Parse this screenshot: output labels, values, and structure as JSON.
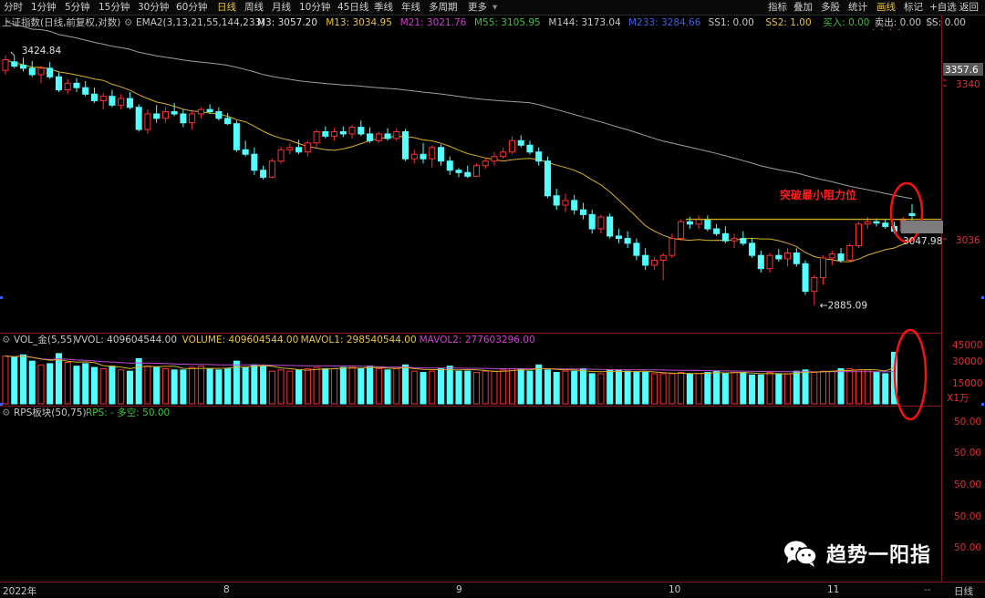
{
  "toolbar": {
    "periods": [
      "分时",
      "1分钟",
      "5分钟",
      "15分钟",
      "30分钟",
      "60分钟",
      "日线",
      "周线",
      "月线",
      "10分钟",
      "45日线",
      "季线",
      "年线",
      "多周期",
      "更多"
    ],
    "active_period": "日线",
    "right_buttons": [
      "指标",
      "叠加",
      "多股",
      "统计",
      "画线",
      "标记",
      "+自选",
      "返回"
    ],
    "active_right": "画线"
  },
  "main": {
    "title": "上证指数(日线,前复权,对数)",
    "indicator_name": "EMA2(3,13,21,55,144,233)",
    "indicators": [
      {
        "label": "M3: 3057.20",
        "color": "#e0e0e0"
      },
      {
        "label": "M13: 3034.95",
        "color": "#e6c43e"
      },
      {
        "label": "M21: 3021.76",
        "color": "#d040d0"
      },
      {
        "label": "M55: 3105.95",
        "color": "#40c040"
      },
      {
        "label": "M144: 3173.04",
        "color": "#c8c8c8"
      },
      {
        "label": "M233: 3284.66",
        "color": "#4060e0"
      },
      {
        "label": "SS1: 0.00",
        "color": "#c8c8c8"
      },
      {
        "label": "SS2: 1.00",
        "color": "#e6c43e"
      },
      {
        "label": "买入: 0.00",
        "color": "#40c040"
      },
      {
        "label": "卖出: 0.00",
        "color": "#c8c8c8"
      },
      {
        "label": "SS: 0.00",
        "color": "#c8c8c8"
      }
    ],
    "price_labels": [
      "3357.6",
      "3340",
      "3036"
    ],
    "high_marker": "3424.84",
    "low_marker": "2885.09",
    "right_marker": "3047.98",
    "annotation": "突破最小阻力位"
  },
  "volume": {
    "name": "VOL_金(5,55)",
    "indicators": [
      {
        "label": "VVOL: 409604544.00",
        "color": "#c8c8c8"
      },
      {
        "label": "VOLUME: 409604544.00",
        "color": "#e6c43e"
      },
      {
        "label": "MAVOL1: 298540544.00",
        "color": "#e6c43e"
      },
      {
        "label": "MAVOL2: 277603296.00",
        "color": "#d040d0"
      }
    ],
    "axis_labels": [
      "45000",
      "30000",
      "15000"
    ],
    "unit": "X1万"
  },
  "rps": {
    "name": "RPS板块(50,75)",
    "label": "RPS: - 多空: 50.00",
    "axis_labels": [
      "50.00",
      "50.00",
      "50.00",
      "50.00",
      "50.00"
    ]
  },
  "bottom": {
    "dates": [
      "2022年",
      "8",
      "9",
      "10",
      "11"
    ],
    "period_label": "日线",
    "dash": "--"
  },
  "watermark": {
    "text": "趋势一阳指",
    "icon": "wechat-icon"
  },
  "colors": {
    "up": "#ff3030",
    "down": "#54ffff",
    "ma_short": "#d9b028",
    "ma_long": "#a0a0a0",
    "annotation": "#ff2020"
  },
  "chart_data": {
    "type": "candlestick",
    "title": "上证指数(日线,前复权,对数)",
    "y_range": [
      2850,
      3470
    ],
    "candles": [
      {
        "o": 3390,
        "h": 3425,
        "l": 3380,
        "c": 3415
      },
      {
        "o": 3410,
        "h": 3424.84,
        "l": 3395,
        "c": 3400
      },
      {
        "o": 3402,
        "h": 3420,
        "l": 3388,
        "c": 3395
      },
      {
        "o": 3395,
        "h": 3412,
        "l": 3375,
        "c": 3380
      },
      {
        "o": 3380,
        "h": 3400,
        "l": 3360,
        "c": 3395
      },
      {
        "o": 3395,
        "h": 3410,
        "l": 3370,
        "c": 3375
      },
      {
        "o": 3375,
        "h": 3385,
        "l": 3340,
        "c": 3345
      },
      {
        "o": 3345,
        "h": 3370,
        "l": 3335,
        "c": 3360
      },
      {
        "o": 3360,
        "h": 3372,
        "l": 3340,
        "c": 3350
      },
      {
        "o": 3350,
        "h": 3365,
        "l": 3330,
        "c": 3335
      },
      {
        "o": 3335,
        "h": 3350,
        "l": 3315,
        "c": 3320
      },
      {
        "o": 3320,
        "h": 3338,
        "l": 3300,
        "c": 3330
      },
      {
        "o": 3330,
        "h": 3345,
        "l": 3305,
        "c": 3310
      },
      {
        "o": 3310,
        "h": 3335,
        "l": 3300,
        "c": 3325
      },
      {
        "o": 3325,
        "h": 3340,
        "l": 3300,
        "c": 3305
      },
      {
        "o": 3305,
        "h": 3312,
        "l": 3250,
        "c": 3255
      },
      {
        "o": 3255,
        "h": 3300,
        "l": 3245,
        "c": 3290
      },
      {
        "o": 3290,
        "h": 3310,
        "l": 3270,
        "c": 3280
      },
      {
        "o": 3280,
        "h": 3305,
        "l": 3270,
        "c": 3295
      },
      {
        "o": 3295,
        "h": 3315,
        "l": 3285,
        "c": 3290
      },
      {
        "o": 3290,
        "h": 3300,
        "l": 3260,
        "c": 3270
      },
      {
        "o": 3270,
        "h": 3295,
        "l": 3255,
        "c": 3290
      },
      {
        "o": 3290,
        "h": 3305,
        "l": 3280,
        "c": 3300
      },
      {
        "o": 3300,
        "h": 3312,
        "l": 3290,
        "c": 3295
      },
      {
        "o": 3295,
        "h": 3305,
        "l": 3275,
        "c": 3280
      },
      {
        "o": 3280,
        "h": 3292,
        "l": 3265,
        "c": 3268
      },
      {
        "o": 3268,
        "h": 3275,
        "l": 3205,
        "c": 3210
      },
      {
        "o": 3210,
        "h": 3230,
        "l": 3195,
        "c": 3200
      },
      {
        "o": 3200,
        "h": 3215,
        "l": 3155,
        "c": 3165
      },
      {
        "o": 3165,
        "h": 3175,
        "l": 3145,
        "c": 3150
      },
      {
        "o": 3150,
        "h": 3190,
        "l": 3148,
        "c": 3185
      },
      {
        "o": 3185,
        "h": 3215,
        "l": 3180,
        "c": 3210
      },
      {
        "o": 3210,
        "h": 3225,
        "l": 3200,
        "c": 3215
      },
      {
        "o": 3215,
        "h": 3232,
        "l": 3200,
        "c": 3205
      },
      {
        "o": 3205,
        "h": 3230,
        "l": 3195,
        "c": 3225
      },
      {
        "o": 3225,
        "h": 3255,
        "l": 3215,
        "c": 3250
      },
      {
        "o": 3250,
        "h": 3262,
        "l": 3235,
        "c": 3240
      },
      {
        "o": 3240,
        "h": 3258,
        "l": 3230,
        "c": 3250
      },
      {
        "o": 3250,
        "h": 3262,
        "l": 3238,
        "c": 3245
      },
      {
        "o": 3245,
        "h": 3265,
        "l": 3235,
        "c": 3260
      },
      {
        "o": 3260,
        "h": 3275,
        "l": 3240,
        "c": 3245
      },
      {
        "o": 3245,
        "h": 3260,
        "l": 3225,
        "c": 3230
      },
      {
        "o": 3230,
        "h": 3250,
        "l": 3225,
        "c": 3245
      },
      {
        "o": 3245,
        "h": 3258,
        "l": 3230,
        "c": 3235
      },
      {
        "o": 3235,
        "h": 3258,
        "l": 3230,
        "c": 3250
      },
      {
        "o": 3250,
        "h": 3256,
        "l": 3185,
        "c": 3190
      },
      {
        "o": 3190,
        "h": 3210,
        "l": 3180,
        "c": 3200
      },
      {
        "o": 3200,
        "h": 3225,
        "l": 3180,
        "c": 3190
      },
      {
        "o": 3190,
        "h": 3220,
        "l": 3170,
        "c": 3215
      },
      {
        "o": 3215,
        "h": 3222,
        "l": 3175,
        "c": 3185
      },
      {
        "o": 3185,
        "h": 3195,
        "l": 3155,
        "c": 3165
      },
      {
        "o": 3165,
        "h": 3170,
        "l": 3150,
        "c": 3160
      },
      {
        "o": 3160,
        "h": 3175,
        "l": 3148,
        "c": 3152
      },
      {
        "o": 3152,
        "h": 3180,
        "l": 3150,
        "c": 3175
      },
      {
        "o": 3175,
        "h": 3192,
        "l": 3168,
        "c": 3185
      },
      {
        "o": 3185,
        "h": 3205,
        "l": 3175,
        "c": 3195
      },
      {
        "o": 3195,
        "h": 3215,
        "l": 3190,
        "c": 3205
      },
      {
        "o": 3205,
        "h": 3240,
        "l": 3200,
        "c": 3230
      },
      {
        "o": 3230,
        "h": 3242,
        "l": 3215,
        "c": 3220
      },
      {
        "o": 3220,
        "h": 3230,
        "l": 3200,
        "c": 3205
      },
      {
        "o": 3205,
        "h": 3215,
        "l": 3175,
        "c": 3185
      },
      {
        "o": 3185,
        "h": 3195,
        "l": 3105,
        "c": 3110
      },
      {
        "o": 3110,
        "h": 3125,
        "l": 3080,
        "c": 3090
      },
      {
        "o": 3090,
        "h": 3115,
        "l": 3075,
        "c": 3100
      },
      {
        "o": 3100,
        "h": 3112,
        "l": 3070,
        "c": 3080
      },
      {
        "o": 3080,
        "h": 3095,
        "l": 3060,
        "c": 3070
      },
      {
        "o": 3070,
        "h": 3080,
        "l": 3030,
        "c": 3040
      },
      {
        "o": 3040,
        "h": 3070,
        "l": 3030,
        "c": 3065
      },
      {
        "o": 3065,
        "h": 3072,
        "l": 3020,
        "c": 3025
      },
      {
        "o": 3025,
        "h": 3040,
        "l": 3010,
        "c": 3020
      },
      {
        "o": 3020,
        "h": 3035,
        "l": 3000,
        "c": 3010
      },
      {
        "o": 3010,
        "h": 3020,
        "l": 2975,
        "c": 2985
      },
      {
        "o": 2985,
        "h": 3000,
        "l": 2955,
        "c": 2965
      },
      {
        "o": 2965,
        "h": 2982,
        "l": 2955,
        "c": 2975
      },
      {
        "o": 2975,
        "h": 2990,
        "l": 2935,
        "c": 2985
      },
      {
        "o": 2985,
        "h": 3030,
        "l": 2980,
        "c": 3020
      },
      {
        "o": 3020,
        "h": 3060,
        "l": 3015,
        "c": 3055
      },
      {
        "o": 3055,
        "h": 3065,
        "l": 3040,
        "c": 3050
      },
      {
        "o": 3050,
        "h": 3068,
        "l": 3040,
        "c": 3060
      },
      {
        "o": 3060,
        "h": 3068,
        "l": 3035,
        "c": 3040
      },
      {
        "o": 3040,
        "h": 3050,
        "l": 3025,
        "c": 3030
      },
      {
        "o": 3030,
        "h": 3045,
        "l": 3010,
        "c": 3015
      },
      {
        "o": 3015,
        "h": 3030,
        "l": 3000,
        "c": 3020
      },
      {
        "o": 3020,
        "h": 3035,
        "l": 3005,
        "c": 3010
      },
      {
        "o": 3010,
        "h": 3020,
        "l": 2980,
        "c": 2985
      },
      {
        "o": 2985,
        "h": 2995,
        "l": 2950,
        "c": 2958
      },
      {
        "o": 2958,
        "h": 2990,
        "l": 2950,
        "c": 2985
      },
      {
        "o": 2985,
        "h": 2998,
        "l": 2972,
        "c": 2978
      },
      {
        "o": 2978,
        "h": 3000,
        "l": 2962,
        "c": 2990
      },
      {
        "o": 2990,
        "h": 3000,
        "l": 2962,
        "c": 2968
      },
      {
        "o": 2968,
        "h": 2975,
        "l": 2905,
        "c": 2912
      },
      {
        "o": 2912,
        "h": 2945,
        "l": 2885.09,
        "c": 2940
      },
      {
        "o": 2940,
        "h": 2985,
        "l": 2925,
        "c": 2980
      },
      {
        "o": 2980,
        "h": 2995,
        "l": 2965,
        "c": 2988
      },
      {
        "o": 2988,
        "h": 3000,
        "l": 2970,
        "c": 2975
      },
      {
        "o": 2975,
        "h": 3010,
        "l": 2972,
        "c": 3005
      },
      {
        "o": 3005,
        "h": 3055,
        "l": 3000,
        "c": 3050
      },
      {
        "o": 3050,
        "h": 3065,
        "l": 3040,
        "c": 3055
      },
      {
        "o": 3055,
        "h": 3062,
        "l": 3045,
        "c": 3052
      },
      {
        "o": 3052,
        "h": 3060,
        "l": 3040,
        "c": 3045
      },
      {
        "o": 3045,
        "h": 3055,
        "l": 3030,
        "c": 3035
      },
      {
        "o": 3035,
        "h": 3065,
        "l": 3030,
        "c": 3058
      },
      {
        "o": 3072,
        "h": 3092,
        "l": 3055,
        "c": 3068
      }
    ],
    "volumes": [
      3.8,
      3.7,
      3.9,
      3.4,
      3.1,
      3.2,
      4.0,
      3.3,
      3.0,
      3.2,
      2.9,
      2.8,
      3.0,
      2.7,
      2.6,
      3.6,
      3.0,
      2.9,
      2.8,
      2.7,
      2.7,
      2.9,
      3.0,
      2.8,
      2.7,
      2.8,
      3.4,
      2.9,
      3.1,
      3.0,
      2.6,
      2.7,
      2.6,
      2.7,
      2.8,
      2.9,
      2.8,
      2.8,
      2.9,
      2.9,
      2.8,
      3.0,
      2.8,
      2.7,
      2.8,
      3.1,
      2.6,
      2.5,
      2.6,
      2.8,
      3.0,
      2.6,
      2.6,
      2.5,
      2.6,
      2.6,
      2.7,
      2.8,
      2.8,
      2.6,
      3.1,
      2.7,
      2.5,
      2.6,
      2.6,
      2.8,
      2.4,
      2.4,
      2.7,
      2.7,
      2.6,
      2.5,
      2.5,
      2.4,
      2.4,
      2.4,
      2.5,
      2.4,
      2.4,
      2.5,
      2.6,
      2.4,
      2.5,
      2.5,
      2.3,
      2.3,
      2.5,
      2.4,
      2.4,
      2.6,
      2.7,
      2.5,
      2.6,
      2.6,
      2.8,
      2.8,
      2.7,
      2.7,
      2.5,
      2.4,
      4.1
    ],
    "resistance_level": 3060,
    "ylabel": "",
    "xlabel": ""
  }
}
